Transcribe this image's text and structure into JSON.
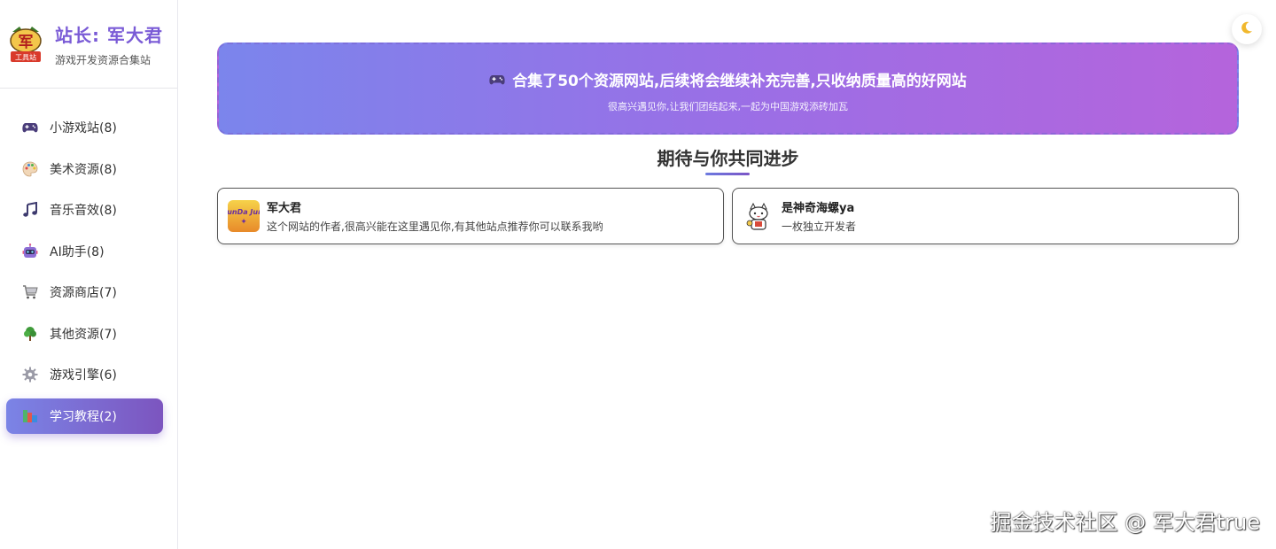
{
  "brand": {
    "title": "站长: 军大君",
    "subtitle": "游戏开发资源合集站",
    "logo_text_top": "军",
    "logo_text_bottom": "工具站"
  },
  "nav": {
    "items": [
      {
        "label": "小游戏站(8)",
        "icon": "gamepad-icon"
      },
      {
        "label": "美术资源(8)",
        "icon": "palette-icon"
      },
      {
        "label": "音乐音效(8)",
        "icon": "music-note-icon"
      },
      {
        "label": "AI助手(8)",
        "icon": "robot-icon"
      },
      {
        "label": "资源商店(7)",
        "icon": "shopping-cart-icon"
      },
      {
        "label": "其他资源(7)",
        "icon": "tree-icon"
      },
      {
        "label": "游戏引擎(6)",
        "icon": "gear-icon"
      },
      {
        "label": "学习教程(2)",
        "icon": "books-icon",
        "active": true
      }
    ]
  },
  "banner": {
    "headline": "合集了50个资源网站,后续将会继续补充完善,只收纳质量高的好网站",
    "subtext": "很高兴遇见你,让我们团结起来,一起为中国游戏添砖加瓦"
  },
  "section": {
    "title": "期待与你共同进步"
  },
  "cards": [
    {
      "name": "军大君",
      "desc": "这个网站的作者,很高兴能在这里遇见你,有其他站点推荐你可以联系我哟",
      "avatar_text": "JunDa Jun"
    },
    {
      "name": "是神奇海螺ya",
      "desc": "一枚独立开发者"
    }
  ],
  "watermark": "掘金技术社区 @ 军大君true",
  "colors": {
    "accent": "#7a5bd6",
    "banner_start": "#7b85ec",
    "banner_end": "#b564dc",
    "active_nav_start": "#7b84e6",
    "active_nav_end": "#7c55bf"
  }
}
